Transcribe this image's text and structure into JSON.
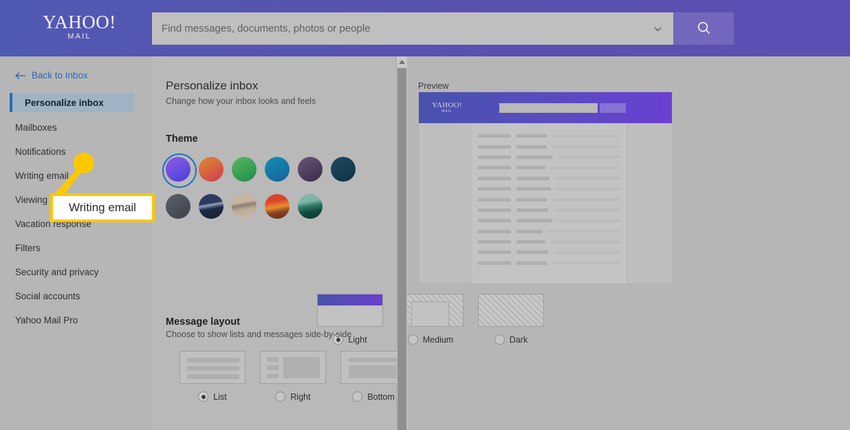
{
  "header": {
    "logo_primary": "YAHOO!",
    "logo_secondary": "MAIL",
    "search_value": "",
    "search_placeholder": "Find messages, documents, photos or people",
    "search_button_icon": "search-icon",
    "dropdown_icon": "chevron-down-icon",
    "background_color": "#5058b0"
  },
  "sidebar": {
    "back_label": "Back to Inbox",
    "back_icon": "arrow-left-icon",
    "back_color": "#2d6ab5",
    "items": [
      {
        "label": "Personalize inbox",
        "active": true
      },
      {
        "label": "Mailboxes",
        "active": false
      },
      {
        "label": "Notifications",
        "active": false
      },
      {
        "label": "Writing email",
        "active": false
      },
      {
        "label": "Viewing email",
        "active": false
      },
      {
        "label": "Vacation response",
        "active": false
      },
      {
        "label": "Filters",
        "active": false
      },
      {
        "label": "Security and privacy",
        "active": false
      },
      {
        "label": "Social accounts",
        "active": false
      },
      {
        "label": "Yahoo Mail Pro",
        "active": false
      }
    ]
  },
  "panel": {
    "title": "Personalize inbox",
    "subtitle": "Change how your inbox looks and feels",
    "theme": {
      "title": "Theme",
      "swatches": [
        {
          "name": "purple-violet",
          "selected": true,
          "color": "#6b4ee0",
          "gradient": "linear-gradient(150deg,#8d5ce8,#4b3fd8)"
        },
        {
          "name": "orange-red",
          "selected": false,
          "color": "#d9573f",
          "gradient": "linear-gradient(150deg,#e08a2e,#cf3b52)"
        },
        {
          "name": "green",
          "selected": false,
          "color": "#2f9e52",
          "gradient": "linear-gradient(150deg,#58b85f,#1f8b4c)"
        },
        {
          "name": "teal-blue",
          "selected": false,
          "color": "#1b7fa8",
          "gradient": "linear-gradient(150deg,#0f93b0,#1a5f9e)"
        },
        {
          "name": "dark-purple",
          "selected": false,
          "color": "#4b3a59",
          "gradient": "linear-gradient(150deg,#6a5578,#3a2c46)"
        },
        {
          "name": "navy",
          "selected": false,
          "color": "#173a52",
          "gradient": "linear-gradient(150deg,#1d4a64,#123044)"
        },
        {
          "name": "charcoal",
          "selected": false,
          "color": "#4a4f57",
          "gradient": "linear-gradient(150deg,#5b6069,#3d424a)"
        },
        {
          "name": "night-lake",
          "selected": false,
          "color": "#24324f",
          "gradient": "linear-gradient(170deg,#2b3a5e 38%,#8fa3c0 44%,#1e2b45 58%,#151f33)"
        },
        {
          "name": "desert-beige",
          "selected": false,
          "color": "#b39f8a",
          "gradient": "linear-gradient(170deg,#c6b49e 35%,#8d7f6e 45%,#b9ab97 60%,#cdbfa9)"
        },
        {
          "name": "sunset",
          "selected": false,
          "color": "#d0582c",
          "gradient": "linear-gradient(170deg,#d8452c 30%,#e8902c 52%,#8c4424 70%,#5a2a18)"
        },
        {
          "name": "teal-mountain",
          "selected": false,
          "color": "#3c8d7c",
          "gradient": "linear-gradient(170deg,#7fb4a6 32%,#2f7a68 48%,#0f4a3e 70%,#0b3a31)"
        }
      ]
    },
    "density": {
      "options": [
        {
          "label": "Light",
          "selected": true,
          "style": "light"
        },
        {
          "label": "Medium",
          "selected": false,
          "style": "medium"
        },
        {
          "label": "Dark",
          "selected": false,
          "style": "dark"
        }
      ]
    },
    "message_layout": {
      "title": "Message layout",
      "subtitle": "Choose to show lists and messages side-by-side",
      "options": [
        {
          "label": "List",
          "selected": true,
          "style": "list"
        },
        {
          "label": "Right",
          "selected": false,
          "style": "right"
        },
        {
          "label": "Bottom",
          "selected": false,
          "style": "bottom"
        }
      ]
    }
  },
  "preview": {
    "label": "Preview",
    "logo_primary": "YAHOO!",
    "logo_secondary": "MAIL",
    "header_gradient_start": "#4852ad",
    "header_gradient_end": "#6a3fd2",
    "row_count": 13
  },
  "callout": {
    "text": "Writing email",
    "accent_color": "#ffc800"
  },
  "scrollbar": {
    "up_icon": "triangle-up-icon"
  }
}
